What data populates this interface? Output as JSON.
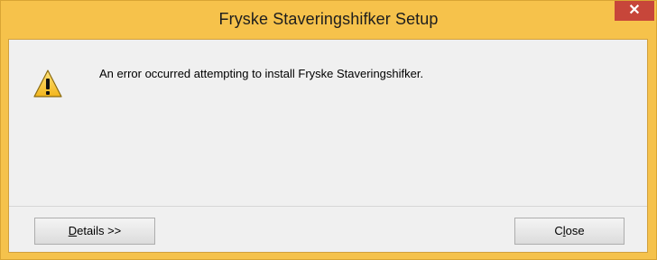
{
  "window": {
    "title": "Fryske Staveringshifker Setup",
    "close_glyph": "✕"
  },
  "message": {
    "icon": "warning-icon",
    "text": "An error occurred attempting to install Fryske Staveringshifker."
  },
  "buttons": {
    "details": {
      "mnemonic": "D",
      "rest": "etails >>"
    },
    "close": {
      "before": "C",
      "mnemonic": "l",
      "after": "ose"
    }
  },
  "colors": {
    "titlebar": "#f6c24b",
    "close_button": "#c7463a",
    "client_bg": "#f0f0f0"
  }
}
